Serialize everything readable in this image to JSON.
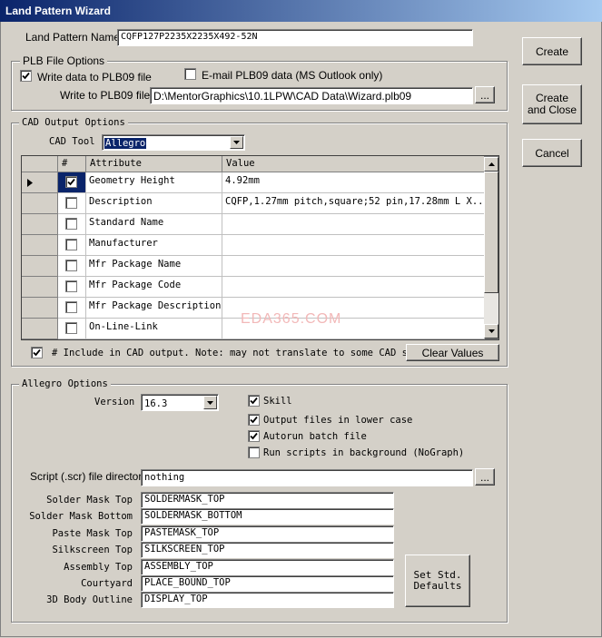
{
  "window": {
    "title": "Land Pattern Wizard"
  },
  "land_pattern": {
    "label": "Land Pattern Name",
    "value": "CQFP127P2235X2235X492-52N"
  },
  "plb": {
    "group_label": "PLB File Options",
    "write_data_label": "Write data to PLB09 file",
    "write_data_checked": true,
    "email_label": "E-mail PLB09 data  (MS Outlook only)",
    "email_checked": false,
    "write_to_label": "Write to PLB09 file",
    "path": "D:\\MentorGraphics\\10.1LPW\\CAD Data\\Wizard.plb09",
    "browse_label": "..."
  },
  "buttons": {
    "create": "Create",
    "create_close": "Create\nand Close",
    "cancel": "Cancel"
  },
  "cad_output": {
    "group_label": "CAD Output Options",
    "tool_label": "CAD Tool",
    "tool_value": "Allegro",
    "columns": {
      "num": "#",
      "attribute": "Attribute",
      "value": "Value"
    },
    "rows": [
      {
        "attribute": "Geometry Height",
        "value": "4.92mm",
        "checked": true,
        "current": true
      },
      {
        "attribute": "Description",
        "value": "CQFP,1.27mm pitch,square;52 pin,17.28mm L X...",
        "checked": false
      },
      {
        "attribute": "Standard Name",
        "value": "",
        "checked": false
      },
      {
        "attribute": "Manufacturer",
        "value": "",
        "checked": false
      },
      {
        "attribute": "Mfr Package Name",
        "value": "",
        "checked": false
      },
      {
        "attribute": "Mfr Package Code",
        "value": "",
        "checked": false
      },
      {
        "attribute": "Mfr Package Description",
        "value": "",
        "checked": false
      },
      {
        "attribute": "On-Line-Link",
        "value": "",
        "checked": false
      }
    ],
    "include_label": "# Include in CAD output.  Note: may not translate to some CAD sof",
    "include_checked": true,
    "clear_values": "Clear Values"
  },
  "watermark": "EDA365.COM",
  "allegro": {
    "group_label": "Allegro Options",
    "version_label": "Version",
    "version_value": "16.3",
    "skill_label": "Skill",
    "skill_checked": true,
    "lowercase_label": "Output files in lower case",
    "lowercase_checked": true,
    "autorun_label": "Autorun batch file",
    "autorun_checked": true,
    "background_label": "Run scripts in background (NoGraph)",
    "background_checked": false,
    "script_dir_label": "Script (.scr) file directory",
    "script_dir_value": "nothing",
    "browse_label": "...",
    "layers": [
      {
        "label": "Solder Mask Top",
        "value": "SOLDERMASK_TOP"
      },
      {
        "label": "Solder Mask Bottom",
        "value": "SOLDERMASK_BOTTOM"
      },
      {
        "label": "Paste Mask Top",
        "value": "PASTEMASK_TOP"
      },
      {
        "label": "Silkscreen Top",
        "value": "SILKSCREEN_TOP"
      },
      {
        "label": "Assembly Top",
        "value": "ASSEMBLY_TOP"
      },
      {
        "label": "Courtyard",
        "value": "PLACE_BOUND_TOP"
      },
      {
        "label": "3D Body Outline",
        "value": "DISPLAY_TOP"
      }
    ],
    "set_std_defaults": "Set Std.\nDefaults"
  }
}
